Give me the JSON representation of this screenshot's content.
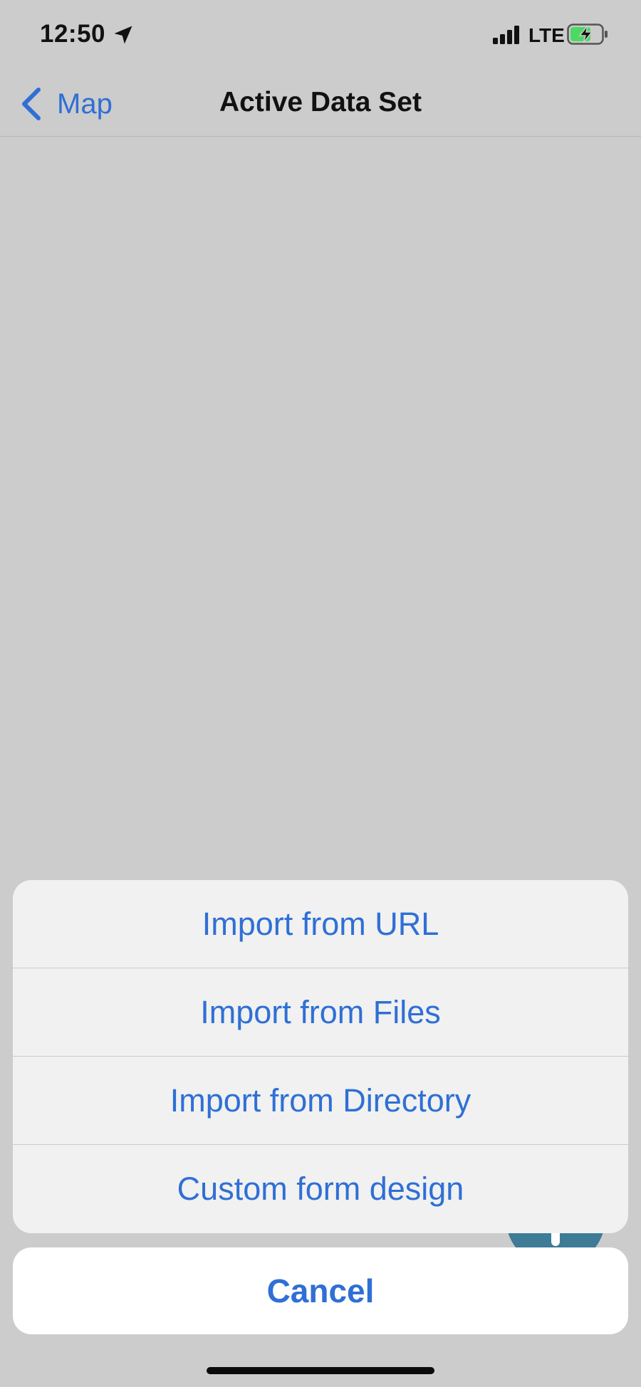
{
  "status_bar": {
    "time": "12:50",
    "network": "LTE",
    "icons": [
      "location-arrow-icon",
      "cellular-signal-icon",
      "battery-charging-icon"
    ]
  },
  "nav": {
    "back_label": "Map",
    "title": "Active Data Set"
  },
  "action_sheet": {
    "items": [
      {
        "label": "Import from URL"
      },
      {
        "label": "Import from Files"
      },
      {
        "label": "Import from Directory"
      },
      {
        "label": "Custom form design"
      }
    ],
    "cancel_label": "Cancel"
  },
  "colors": {
    "accent": "#2f6fd6",
    "background_dimmed": "#cbcccb",
    "sheet_background": "#f0f1f0",
    "battery_fill": "#4cd964"
  }
}
